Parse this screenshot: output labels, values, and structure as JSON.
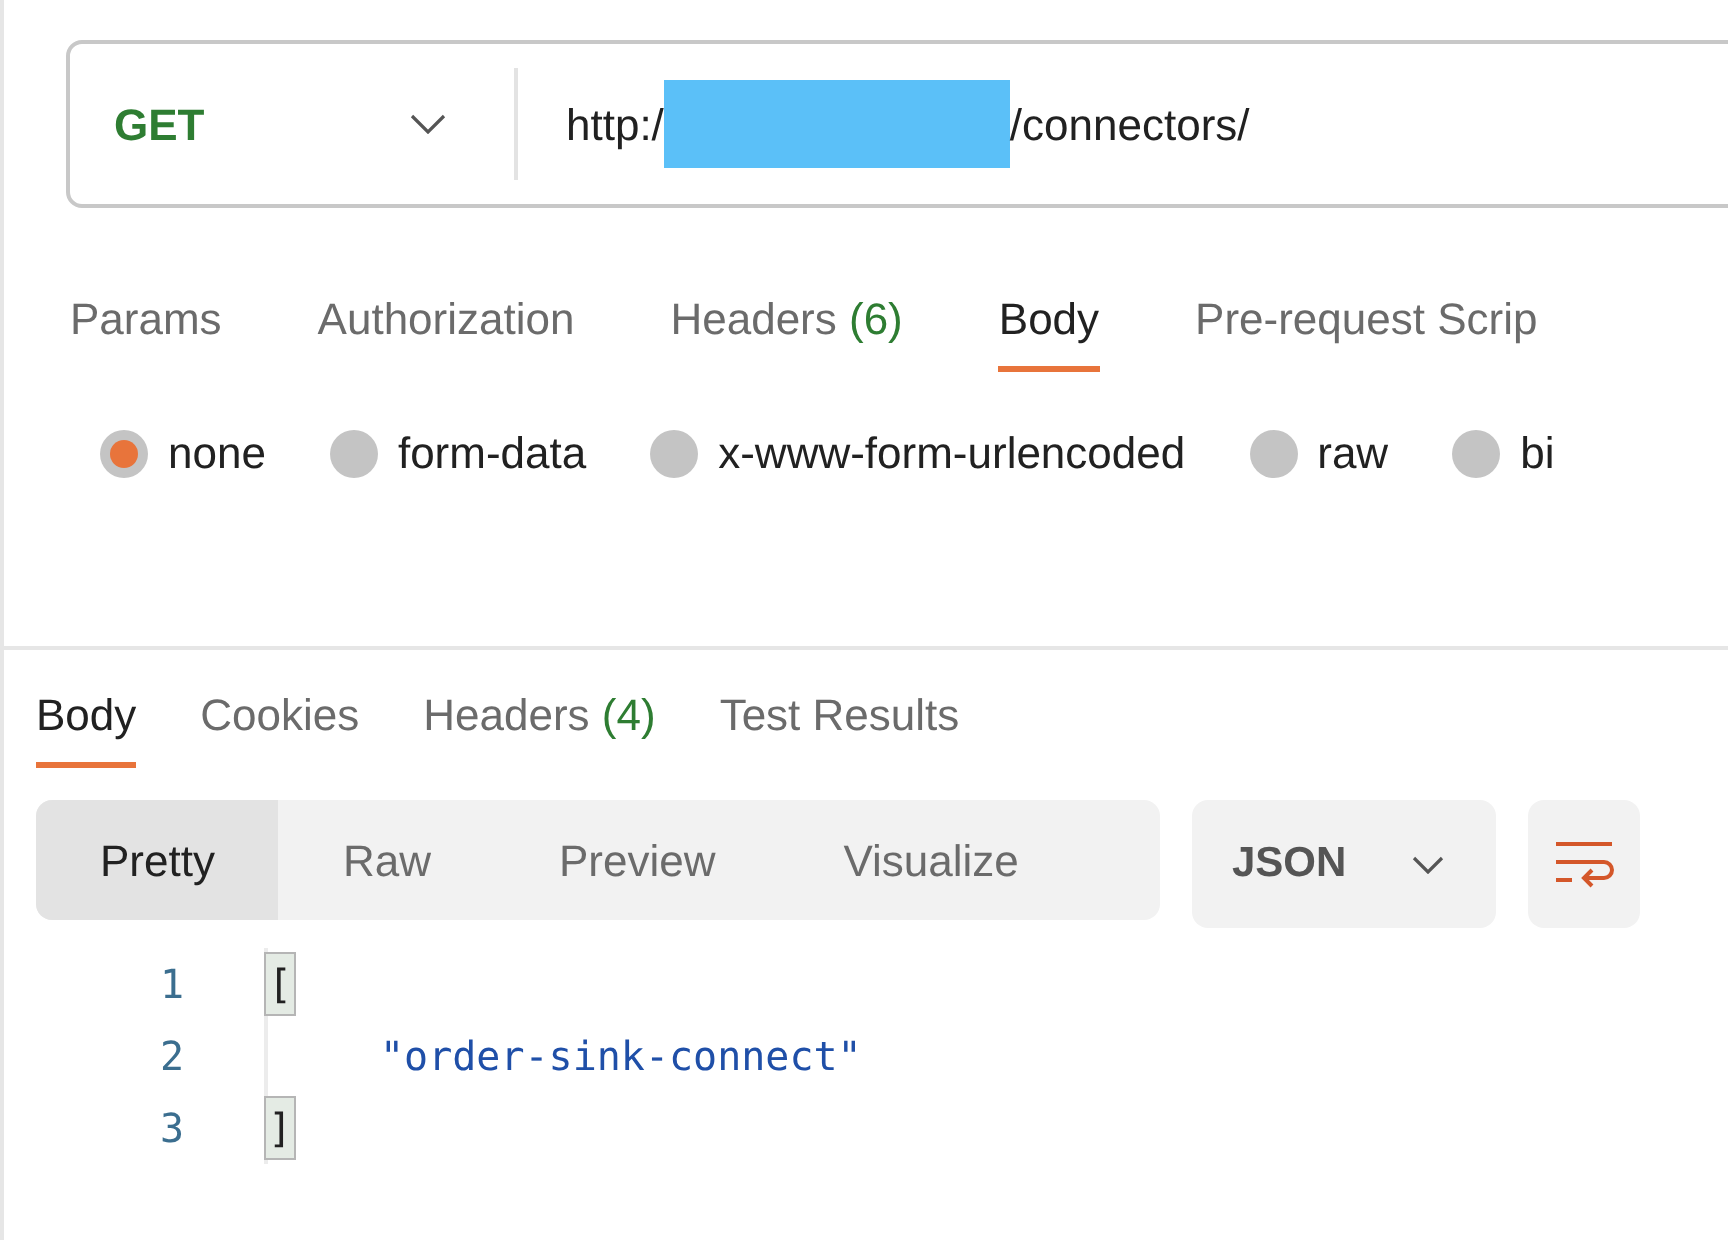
{
  "request": {
    "method": "GET",
    "url_start": "http:/",
    "url_end": "/connectors/",
    "redacted": true
  },
  "request_tabs": [
    {
      "label": "Params",
      "selected": false
    },
    {
      "label": "Authorization",
      "selected": false
    },
    {
      "label": "Headers",
      "count": "(6)",
      "selected": false
    },
    {
      "label": "Body",
      "selected": true
    },
    {
      "label": "Pre-request Scrip",
      "selected": false
    }
  ],
  "body_types": [
    {
      "label": "none",
      "selected": true
    },
    {
      "label": "form-data",
      "selected": false
    },
    {
      "label": "x-www-form-urlencoded",
      "selected": false
    },
    {
      "label": "raw",
      "selected": false
    },
    {
      "label": "bi",
      "selected": false
    }
  ],
  "response_tabs": [
    {
      "label": "Body",
      "selected": true
    },
    {
      "label": "Cookies",
      "selected": false
    },
    {
      "label": "Headers",
      "count": "(4)",
      "selected": false
    },
    {
      "label": "Test Results",
      "selected": false
    }
  ],
  "view_modes": [
    {
      "label": "Pretty",
      "selected": true
    },
    {
      "label": "Raw",
      "selected": false
    },
    {
      "label": "Preview",
      "selected": false
    },
    {
      "label": "Visualize",
      "selected": false
    }
  ],
  "format": "JSON",
  "code_lines": [
    {
      "number": "1",
      "text": "[",
      "kind": "bracket"
    },
    {
      "number": "2",
      "text": "\"order-sink-connect\"",
      "kind": "string"
    },
    {
      "number": "3",
      "text": "]",
      "kind": "bracket"
    }
  ]
}
